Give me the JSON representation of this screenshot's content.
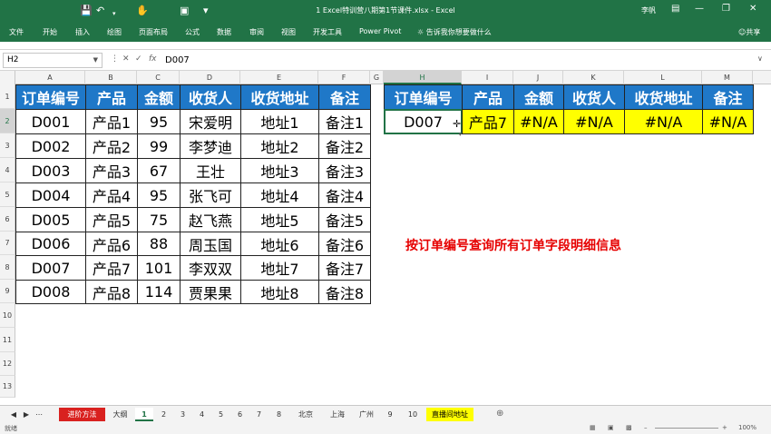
{
  "titlebar": {
    "save_icon": "save-icon",
    "undo_icon": "undo-icon",
    "title": "1 Excel特训营八期第1节课件.xlsx - Excel",
    "user": "李帆"
  },
  "ribbon": {
    "tabs": [
      "文件",
      "开始",
      "插入",
      "绘图",
      "页面布局",
      "公式",
      "数据",
      "审阅",
      "视图",
      "开发工具",
      "Power Pivot"
    ],
    "tell_me": "告诉我你想要做什么",
    "share": "共享"
  },
  "formula_bar": {
    "name_box": "H2",
    "fx": "fx",
    "content": "D007"
  },
  "columns": [
    {
      "label": "A",
      "selected": false
    },
    {
      "label": "B",
      "selected": false
    },
    {
      "label": "C",
      "selected": false
    },
    {
      "label": "D",
      "selected": false
    },
    {
      "label": "E",
      "selected": false
    },
    {
      "label": "F",
      "selected": false
    },
    {
      "label": "G",
      "selected": false
    },
    {
      "label": "H",
      "selected": true
    },
    {
      "label": "I",
      "selected": false
    },
    {
      "label": "J",
      "selected": false
    },
    {
      "label": "K",
      "selected": false
    },
    {
      "label": "L",
      "selected": false
    },
    {
      "label": "M",
      "selected": false
    }
  ],
  "rows": [
    "1",
    "2",
    "3",
    "4",
    "5",
    "6",
    "7",
    "8",
    "9",
    "10",
    "11",
    "12",
    "13"
  ],
  "selected_row": "2",
  "source_table": {
    "headers": [
      "订单编号",
      "产品",
      "金额",
      "收货人",
      "收货地址",
      "备注"
    ],
    "rows": [
      [
        "D001",
        "产品1",
        "95",
        "宋爱明",
        "地址1",
        "备注1"
      ],
      [
        "D002",
        "产品2",
        "99",
        "李梦迪",
        "地址2",
        "备注2"
      ],
      [
        "D003",
        "产品3",
        "67",
        "王壮",
        "地址3",
        "备注3"
      ],
      [
        "D004",
        "产品4",
        "95",
        "张飞可",
        "地址4",
        "备注4"
      ],
      [
        "D005",
        "产品5",
        "75",
        "赵飞燕",
        "地址5",
        "备注5"
      ],
      [
        "D006",
        "产品6",
        "88",
        "周玉国",
        "地址6",
        "备注6"
      ],
      [
        "D007",
        "产品7",
        "101",
        "李双双",
        "地址7",
        "备注7"
      ],
      [
        "D008",
        "产品8",
        "114",
        "贾果果",
        "地址8",
        "备注8"
      ]
    ]
  },
  "lookup_table": {
    "headers": [
      "订单编号",
      "产品",
      "金额",
      "收货人",
      "收货地址",
      "备注"
    ],
    "row": [
      "D007",
      "产品7",
      "#N/A",
      "#N/A",
      "#N/A",
      "#N/A"
    ]
  },
  "caption": "按订单编号查询所有订单字段明细信息",
  "sheets": [
    {
      "label": "进阶方法",
      "style": "red"
    },
    {
      "label": "大纲",
      "style": ""
    },
    {
      "label": "1",
      "style": "active"
    },
    {
      "label": "2",
      "style": ""
    },
    {
      "label": "3",
      "style": ""
    },
    {
      "label": "4",
      "style": ""
    },
    {
      "label": "5",
      "style": ""
    },
    {
      "label": "6",
      "style": ""
    },
    {
      "label": "7",
      "style": ""
    },
    {
      "label": "8",
      "style": ""
    },
    {
      "label": "北京",
      "style": ""
    },
    {
      "label": "上海",
      "style": ""
    },
    {
      "label": "广州",
      "style": ""
    },
    {
      "label": "9",
      "style": ""
    },
    {
      "label": "10",
      "style": ""
    },
    {
      "label": "直播间地址",
      "style": "yellow"
    }
  ],
  "status": {
    "ready": "就绪",
    "zoom": "100%"
  },
  "colors": {
    "excel_green": "#217346",
    "header_blue": "#1f78c8",
    "highlight_yellow": "#ffff00",
    "caption_red": "#e60000"
  }
}
